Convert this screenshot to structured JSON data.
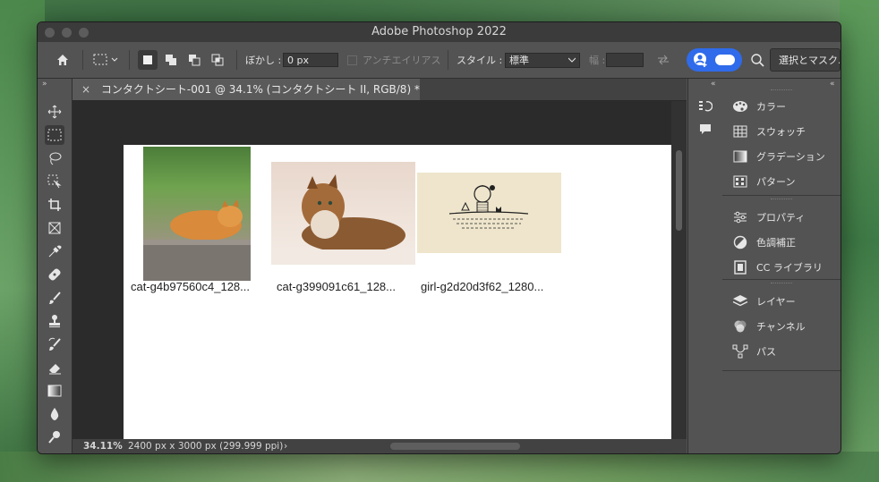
{
  "window": {
    "title": "Adobe Photoshop 2022"
  },
  "options_bar": {
    "feather_label": "ぼかし :",
    "feather_value": "0 px",
    "antialias_label": "アンチエイリアス",
    "style_label": "スタイル :",
    "style_value": "標準",
    "width_label": "幅 :",
    "select_mask_label": "選択とマスク..."
  },
  "document": {
    "tab_title": "コンタクトシート-001 @ 34.1% (コンタクトシート II, RGB/8) *",
    "close_glyph": "×",
    "zoom": "34.11%",
    "doc_info": "2400 px x 3000 px (299.999 ppi)",
    "thumbnails": [
      {
        "caption": "cat-g4b97560c4_128..."
      },
      {
        "caption": "cat-g399091c61_128..."
      },
      {
        "caption": "girl-g2d20d3f62_1280..."
      }
    ]
  },
  "panels": {
    "group1": [
      {
        "label": "カラー",
        "icon": "palette-icon"
      },
      {
        "label": "スウォッチ",
        "icon": "grid-icon"
      },
      {
        "label": "グラデーション",
        "icon": "gradient-icon"
      },
      {
        "label": "パターン",
        "icon": "pattern-icon"
      }
    ],
    "group2": [
      {
        "label": "プロパティ",
        "icon": "sliders-icon"
      },
      {
        "label": "色調補正",
        "icon": "adjust-icon"
      },
      {
        "label": "CC ライブラリ",
        "icon": "library-icon"
      }
    ],
    "group3": [
      {
        "label": "レイヤー",
        "icon": "layers-icon"
      },
      {
        "label": "チャンネル",
        "icon": "channels-icon"
      },
      {
        "label": "パス",
        "icon": "paths-icon"
      }
    ]
  },
  "colors": {
    "accent": "#2f6bea",
    "chrome": "#535353",
    "canvas": "#ffffff"
  }
}
